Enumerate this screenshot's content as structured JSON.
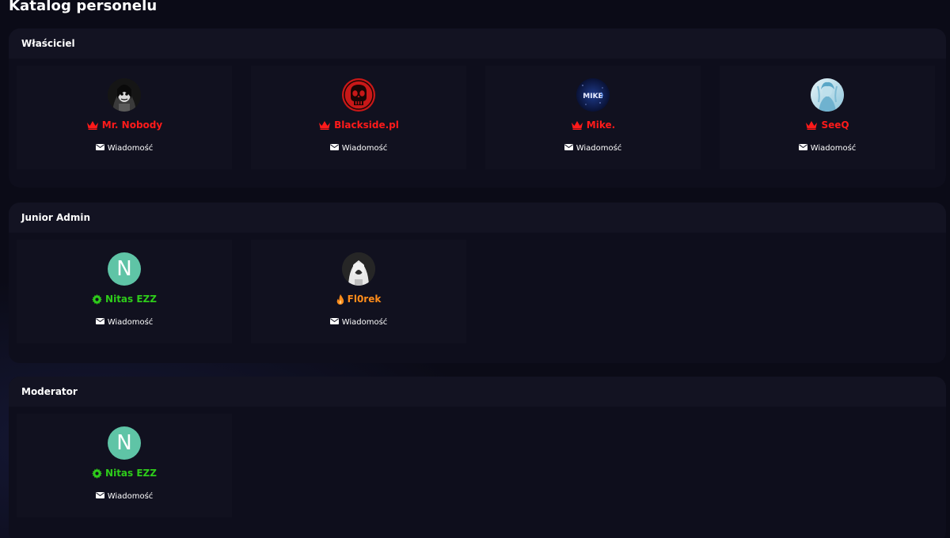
{
  "page": {
    "title": "Katalog personelu"
  },
  "message_label": "Wiadomość",
  "colors": {
    "owner": "#ff1a1a",
    "junior": "#2ecc1a",
    "fire": "#ff8c1a",
    "avatar_letter_bg": "#5fc4a6"
  },
  "sections": [
    {
      "title": "Właściciel",
      "members": [
        {
          "name": "Mr. Nobody",
          "role_icon": "crown-icon",
          "avatar": "dark-portrait"
        },
        {
          "name": "Blackside.pl",
          "role_icon": "crown-icon",
          "avatar": "red-skull"
        },
        {
          "name": "Mike.",
          "role_icon": "crown-icon",
          "avatar": "mike-logo",
          "avatar_text": "MIKE"
        },
        {
          "name": "SeeQ",
          "role_icon": "crown-icon",
          "avatar": "light-blue-portrait"
        }
      ]
    },
    {
      "title": "Junior Admin",
      "members": [
        {
          "name": "Nitas EZZ",
          "role_icon": "gear-icon",
          "avatar": "letter",
          "avatar_letter": "N"
        },
        {
          "name": "Fl0rek",
          "role_icon": "fire-icon",
          "avatar": "grey-portrait"
        }
      ]
    },
    {
      "title": "Moderator",
      "members": [
        {
          "name": "Nitas EZZ",
          "role_icon": "gear-icon",
          "avatar": "letter",
          "avatar_letter": "N"
        }
      ]
    }
  ]
}
